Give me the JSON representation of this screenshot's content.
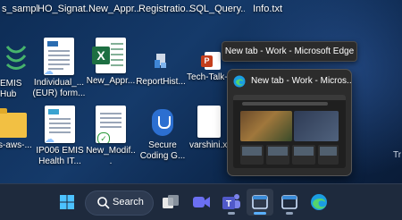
{
  "desktop": {
    "top_row_labels": [
      "s_sampl...",
      "HO_Signat...",
      "New_Appr...",
      "Registratio...",
      "SQL_Query...",
      "Info.txt"
    ],
    "row1": [
      {
        "label": "EMIS Hub",
        "icon": "green-logo-icon"
      },
      {
        "label": "Individual_... (EUR) form...",
        "icon": "document-icon"
      },
      {
        "label": "New_Appr...",
        "icon": "excel-icon"
      },
      {
        "label": "ReportHist...",
        "icon": "report-icon"
      },
      {
        "label": "Tech-Talk-...",
        "icon": "powerpoint-icon"
      }
    ],
    "row2": [
      {
        "label": "s-aws-...",
        "icon": "folder-icon"
      },
      {
        "label": "IP006 EMIS Health IT...",
        "icon": "document-icon"
      },
      {
        "label": "New_Modif...",
        "icon": "document-icon"
      },
      {
        "label": "Secure Coding G...",
        "icon": "shield-icon"
      },
      {
        "label": "varshini.xr...",
        "icon": "blank-file-icon"
      }
    ]
  },
  "tooltip": {
    "text": "New tab - Work - Microsoft Edge"
  },
  "thumbnail": {
    "title": "New tab - Work - Micros...",
    "icon": "edge-icon"
  },
  "side_text": "Tr",
  "taskbar": {
    "search_label": "Search",
    "items": [
      {
        "name": "start-button",
        "icon": "windows-logo-icon"
      },
      {
        "name": "task-view-button",
        "icon": "task-view-icon"
      },
      {
        "name": "meet-button",
        "icon": "meet-camera-icon"
      },
      {
        "name": "teams-button",
        "icon": "teams-icon"
      },
      {
        "name": "edge-work-button",
        "icon": "edge-window-icon"
      },
      {
        "name": "edge-personal-button",
        "icon": "edge-window-icon"
      },
      {
        "name": "edge-browser-button",
        "icon": "edge-icon"
      }
    ]
  }
}
